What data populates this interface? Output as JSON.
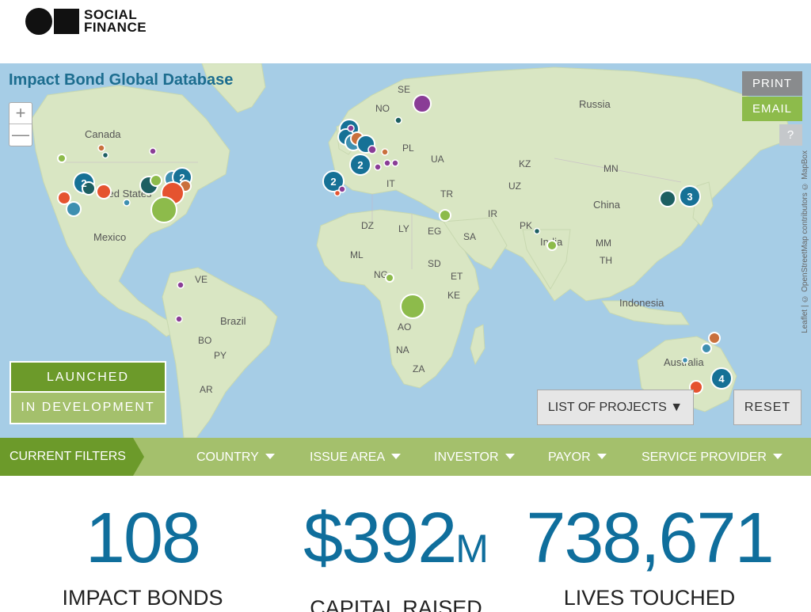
{
  "brand": {
    "line1": "SOCIAL",
    "line2": "FINANCE"
  },
  "map": {
    "title": "Impact Bond Global Database",
    "zoom_in": "+",
    "zoom_out": "—",
    "attribution": "Leaflet | © OpenStreetMap contributors © MapBox",
    "labels": {
      "canada": "Canada",
      "united_states": "ited States",
      "mexico": "Mexico",
      "brazil": "Brazil",
      "russia": "Russia",
      "china": "China",
      "india": "India",
      "indonesia": "Indonesia",
      "australia": "Australia",
      "se": "SE",
      "no": "NO",
      "pl": "PL",
      "ua": "UA",
      "kz": "KZ",
      "mn": "MN",
      "uz": "UZ",
      "tr": "TR",
      "ir": "IR",
      "pk": "PK",
      "dz": "DZ",
      "ly": "LY",
      "eg": "EG",
      "sa": "SA",
      "ml": "ML",
      "ng": "NG",
      "sd": "SD",
      "et": "ET",
      "ke": "KE",
      "ao": "AO",
      "na": "NA",
      "za": "ZA",
      "ve": "VE",
      "bo": "BO",
      "py": "PY",
      "ar": "AR",
      "it": "IT",
      "mm": "MM",
      "th": "TH"
    },
    "clusters": [
      "2",
      "2",
      "2",
      "2",
      "3",
      "4"
    ],
    "colors": {
      "teal": "#167196",
      "green": "#8dbb4b",
      "red": "#e5532f",
      "purple": "#8a3d96",
      "orange": "#c9703d",
      "dark": "#1d5f62"
    }
  },
  "buttons": {
    "print": "PRINT",
    "email": "EMAIL",
    "help": "?",
    "list_projects": "LIST OF PROJECTS ▼",
    "reset": "RESET"
  },
  "legend": {
    "launched": "LAUNCHED",
    "in_development": "IN DEVELOPMENT"
  },
  "filters": {
    "current": "CURRENT FILTERS",
    "items": [
      "COUNTRY",
      "ISSUE AREA",
      "INVESTOR",
      "PAYOR",
      "SERVICE PROVIDER"
    ]
  },
  "stats": {
    "bonds": {
      "value": "108",
      "label": "IMPACT BONDS"
    },
    "capital": {
      "value": "$392",
      "unit": "M",
      "label": "CAPITAL RAISED"
    },
    "lives": {
      "value": "738,671",
      "label": "LIVES TOUCHED"
    }
  }
}
